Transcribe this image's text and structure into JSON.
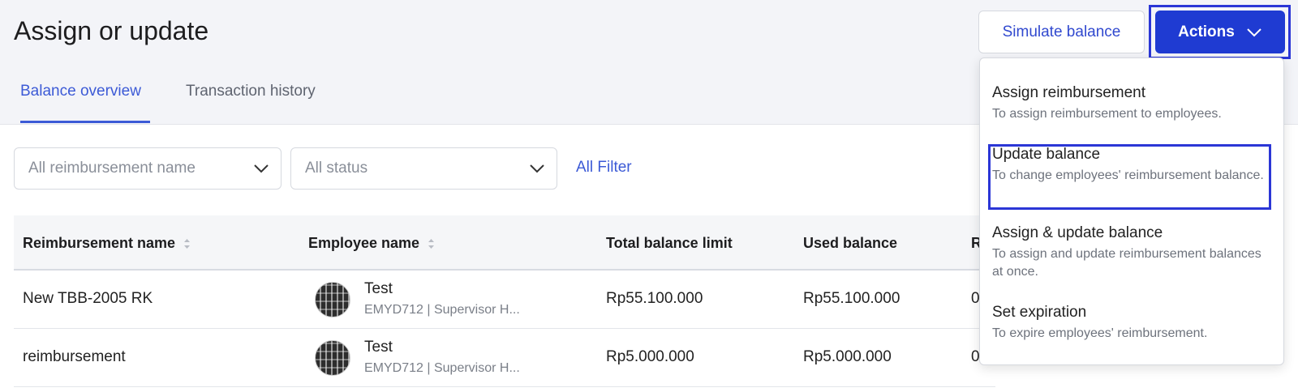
{
  "page": {
    "title": "Assign or update"
  },
  "tabs": [
    {
      "label": "Balance overview",
      "active": true
    },
    {
      "label": "Transaction history",
      "active": false
    }
  ],
  "header_buttons": {
    "simulate": "Simulate balance",
    "actions": "Actions"
  },
  "filters": {
    "reimbursement_placeholder": "All reimbursement name",
    "status_placeholder": "All status",
    "all_filter": "All Filter"
  },
  "table": {
    "columns": [
      "Reimbursement name",
      "Employee name",
      "Total balance limit",
      "Used balance",
      "R"
    ],
    "rows": [
      {
        "reimbursement": "New TBB-2005 RK",
        "employee_name": "Test",
        "employee_sub": "EMYD712 | Supervisor H...",
        "total_limit": "Rp55.100.000",
        "used": "Rp55.100.000",
        "remaining": "0"
      },
      {
        "reimbursement": "reimbursement",
        "employee_name": "Test",
        "employee_sub": "EMYD712 | Supervisor H...",
        "total_limit": "Rp5.000.000",
        "used": "Rp5.000.000",
        "remaining": "0"
      }
    ]
  },
  "actions_menu": [
    {
      "title": "Assign reimbursement",
      "desc": "To assign reimbursement to employees."
    },
    {
      "title": "Update balance",
      "desc": "To change employees' reimbursement balance."
    },
    {
      "title": "Assign & update balance",
      "desc": "To assign and update reimbursement balances at once."
    },
    {
      "title": "Set expiration",
      "desc": "To expire employees' reimbursement."
    }
  ],
  "colors": {
    "accent": "#1f3bd2",
    "link": "#3c5ad6",
    "highlight_border": "#2b36d6"
  }
}
